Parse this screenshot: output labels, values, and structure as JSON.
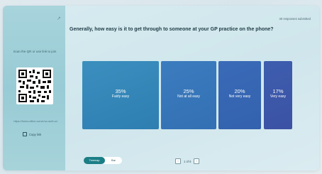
{
  "sidebar": {
    "scan_text": "Scan the QR or use link to join",
    "link": "https://forms.office.com/e/uu ardh.cd",
    "copy_label": "Copy link"
  },
  "header": {
    "responses": "40 responses submitted",
    "question": "Generally, how easy is it to get through to someone at your GP practice on the phone?"
  },
  "tiles": [
    {
      "pct": "35%",
      "label": "Fairly easy"
    },
    {
      "pct": "25%",
      "label": "Not at all easy"
    },
    {
      "pct": "20%",
      "label": "Not very easy"
    },
    {
      "pct": "17%",
      "label": "Very easy"
    }
  ],
  "view_toggle": {
    "active": "Treemap",
    "inactive": "Bar"
  },
  "pager": {
    "text": "1 of 6"
  },
  "icons": [
    "collapse-icon",
    "copy-icon",
    "prev-icon",
    "next-icon"
  ]
}
